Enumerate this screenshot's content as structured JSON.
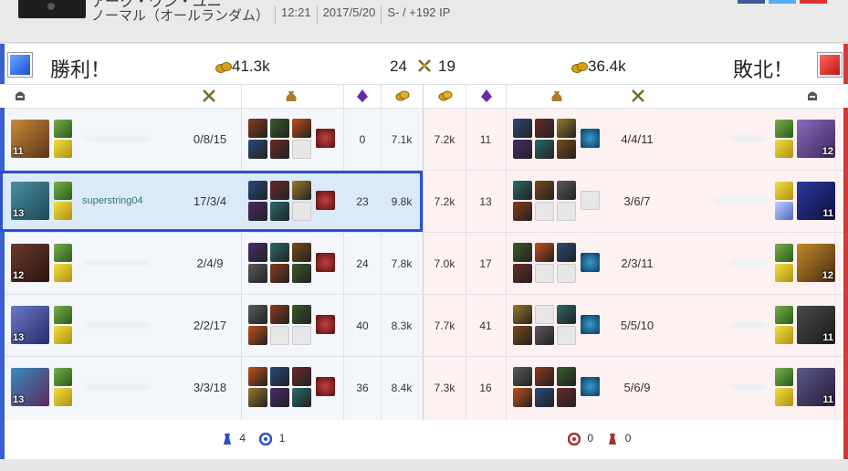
{
  "header": {
    "title": "アーク・ワン・ユニ",
    "mode": "ノーマル（オールランダム）",
    "time": "12:21",
    "date": "2017/5/20",
    "result_ip": "S- / +192 IP"
  },
  "summary": {
    "blue_result": "勝利！",
    "blue_gold": "41.3k",
    "blue_kills": "24",
    "red_kills": "19",
    "red_gold": "36.4k",
    "red_result": "敗北！"
  },
  "colors": {
    "blue_accent": "#2c4fd0",
    "red_accent": "#d23a3a"
  },
  "blue_team": [
    {
      "name": "",
      "level": "11",
      "kda": "0/8/15",
      "cs": "0",
      "gold": "7.1k"
    },
    {
      "name": "superstring04",
      "level": "13",
      "kda": "17/3/4",
      "cs": "23",
      "gold": "9.8k"
    },
    {
      "name": "",
      "level": "12",
      "kda": "2/4/9",
      "cs": "24",
      "gold": "7.8k"
    },
    {
      "name": "",
      "level": "13",
      "kda": "2/2/17",
      "cs": "40",
      "gold": "8.3k"
    },
    {
      "name": "",
      "level": "13",
      "kda": "3/3/18",
      "cs": "36",
      "gold": "8.4k"
    }
  ],
  "red_team": [
    {
      "name": "",
      "level": "12",
      "kda": "4/4/11",
      "cs": "11",
      "gold": "7.2k"
    },
    {
      "name": "",
      "level": "11",
      "kda": "3/6/7",
      "cs": "13",
      "gold": "7.2k"
    },
    {
      "name": "",
      "level": "12",
      "kda": "2/3/11",
      "cs": "17",
      "gold": "7.0k"
    },
    {
      "name": "",
      "level": "11",
      "kda": "5/5/10",
      "cs": "41",
      "gold": "7.7k"
    },
    {
      "name": "",
      "level": "11",
      "kda": "5/6/9",
      "cs": "16",
      "gold": "7.3k"
    }
  ],
  "footer": {
    "blue_towers": "4",
    "blue_inhibs": "1",
    "red_inhibs": "0",
    "red_towers": "0"
  }
}
